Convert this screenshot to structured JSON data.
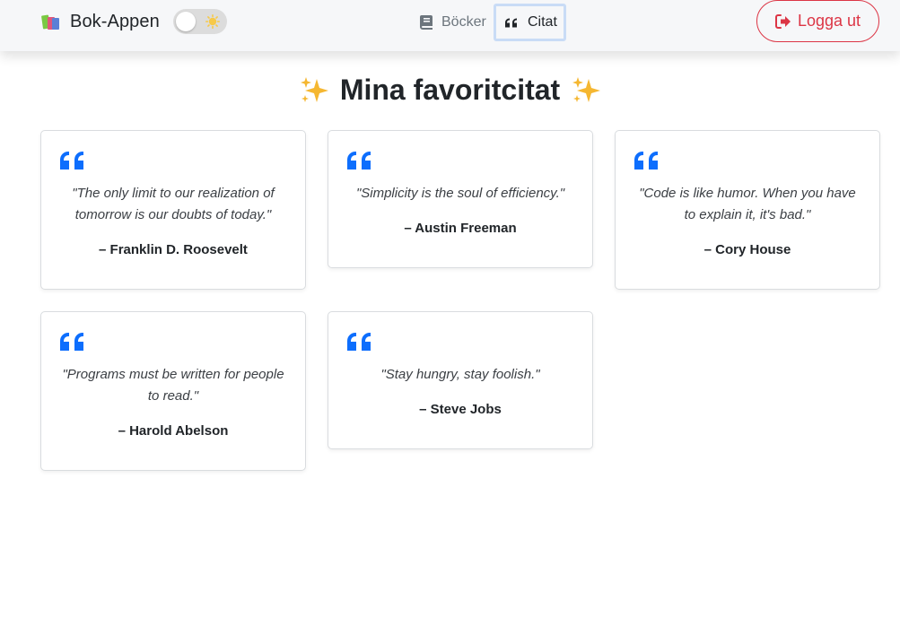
{
  "navbar": {
    "brand": "Bok-Appen",
    "nav": [
      {
        "label": "Böcker",
        "icon": "book-icon"
      },
      {
        "label": "Citat",
        "icon": "quote-icon",
        "active": true
      }
    ],
    "theme_toggle": {
      "icon": "sun-icon",
      "dark_mode": false
    },
    "logout_label": "Logga ut"
  },
  "page": {
    "title": "Mina favoritcitat"
  },
  "quotes": [
    {
      "text": "\"The only limit to our realization of tomorrow is our doubts of today.\"",
      "author": "– Franklin D. Roosevelt"
    },
    {
      "text": "\"Simplicity is the soul of efficiency.\"",
      "author": "– Austin Freeman"
    },
    {
      "text": "\"Code is like humor. When you have to explain it, it's bad.\"",
      "author": "– Cory House"
    },
    {
      "text": "\"Programs must be written for people to read.\"",
      "author": "– Harold Abelson"
    },
    {
      "text": "\"Stay hungry, stay foolish.\"",
      "author": "– Steve Jobs"
    }
  ],
  "colors": {
    "accent": "#0d6efd",
    "danger": "#dc3545",
    "navbar_bg": "#f6f7f9"
  }
}
